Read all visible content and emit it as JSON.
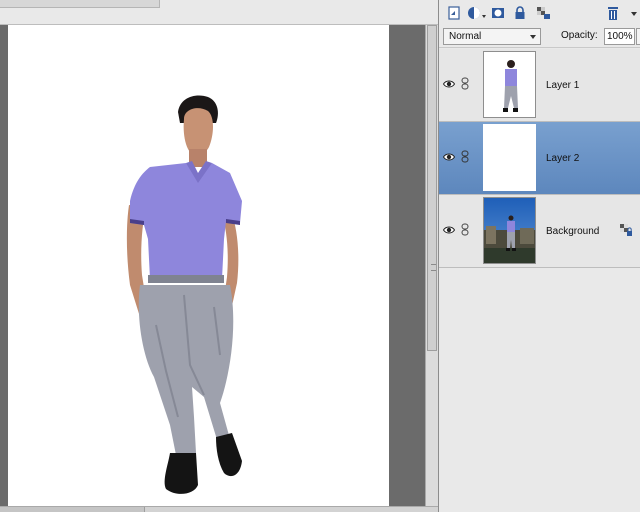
{
  "window": {
    "accent": "#5d87bd"
  },
  "panel": {
    "toolbar_icons": [
      "new-layer-icon",
      "adjustment-layer-icon",
      "layer-mask-icon",
      "lock-all-icon",
      "lock-transparency-icon",
      "delete-layer-icon",
      "panel-menu-icon"
    ],
    "blend_mode": "Normal",
    "opacity_label": "Opacity:",
    "opacity_value": "100%"
  },
  "layers": [
    {
      "name": "Layer 1",
      "visible": true,
      "selected": false,
      "thumbnail": "transparent-with-figure"
    },
    {
      "name": "Layer 2",
      "visible": true,
      "selected": true,
      "thumbnail": "white-fill"
    },
    {
      "name": "Background",
      "visible": true,
      "selected": false,
      "thumbnail": "photo",
      "locked": true
    }
  ],
  "canvas": {
    "content": "person-cutout-on-white",
    "shirt_color": "#8e86dc",
    "pants_color": "#9ea1ad"
  }
}
